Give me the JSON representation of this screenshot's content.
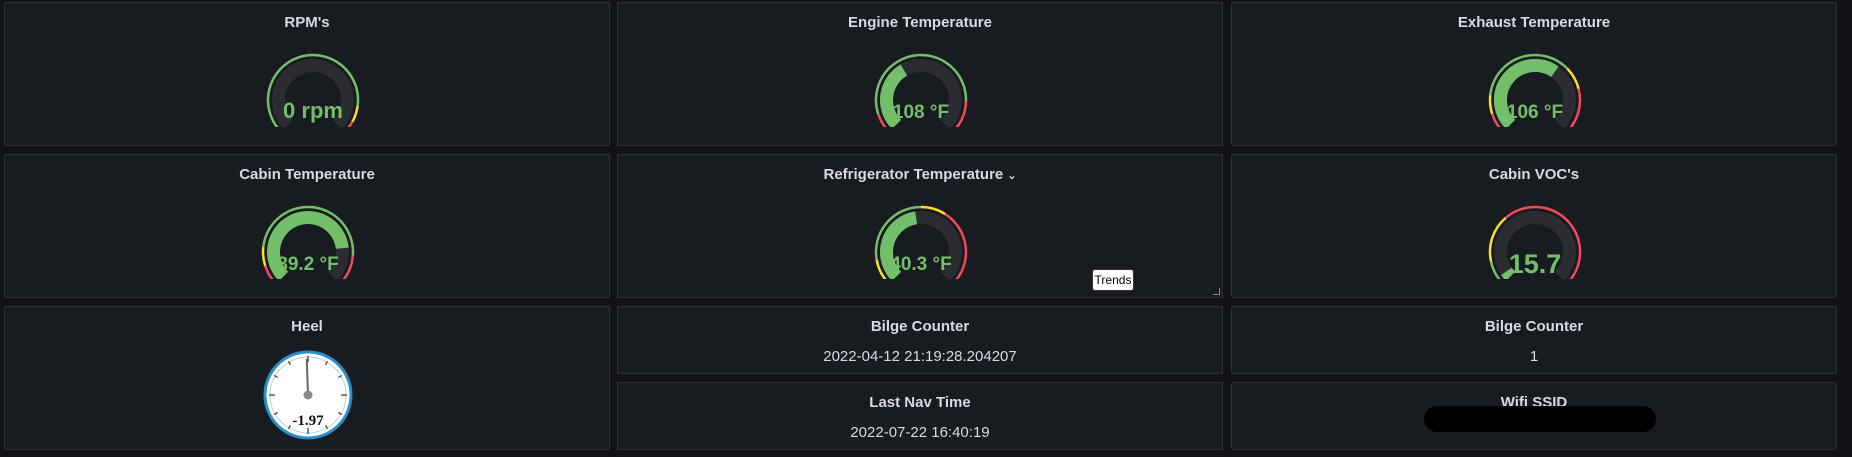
{
  "colors": {
    "background": "#111217",
    "panel": "#181b1f",
    "panel_border": "#2c2f36",
    "gauge_green": "#73bf69",
    "gauge_yellow": "#fade2a",
    "gauge_red": "#f2495c",
    "gauge_track": "#2a2c32",
    "heel_blue": "#2a8fc9"
  },
  "panels": {
    "rpm": {
      "title": "RPM's",
      "value": "0 rpm",
      "fraction": 0
    },
    "engine_temp": {
      "title": "Engine Temperature",
      "value": "108 °F",
      "fraction": 0.39
    },
    "exhaust_temp": {
      "title": "Exhaust Temperature",
      "value": "106 °F",
      "fraction": 0.63
    },
    "cabin_temp": {
      "title": "Cabin Temperature",
      "value": "89.2 °F",
      "fraction": 0.81
    },
    "fridge_temp": {
      "title": "Refrigerator Temperature",
      "menu_icon": "chevron-down-icon",
      "value": "40.3 °F",
      "fraction": 0.47,
      "tooltip": "Trends"
    },
    "cabin_voc": {
      "title": "Cabin VOC's",
      "value": "15.7",
      "fraction": 0.04
    },
    "heel": {
      "title": "Heel",
      "value": "-1.97",
      "angle_degrees": -1.97
    },
    "bilge_counter_time": {
      "title": "Bilge Counter",
      "value": "2022-04-12 21:19:28.204207"
    },
    "bilge_counter_count": {
      "title": "Bilge Counter",
      "value": "1"
    },
    "last_nav_time": {
      "title": "Last Nav Time",
      "value": "2022-07-22 16:40:19"
    },
    "wifi_ssid": {
      "title": "Wifi SSID",
      "value": ""
    }
  }
}
